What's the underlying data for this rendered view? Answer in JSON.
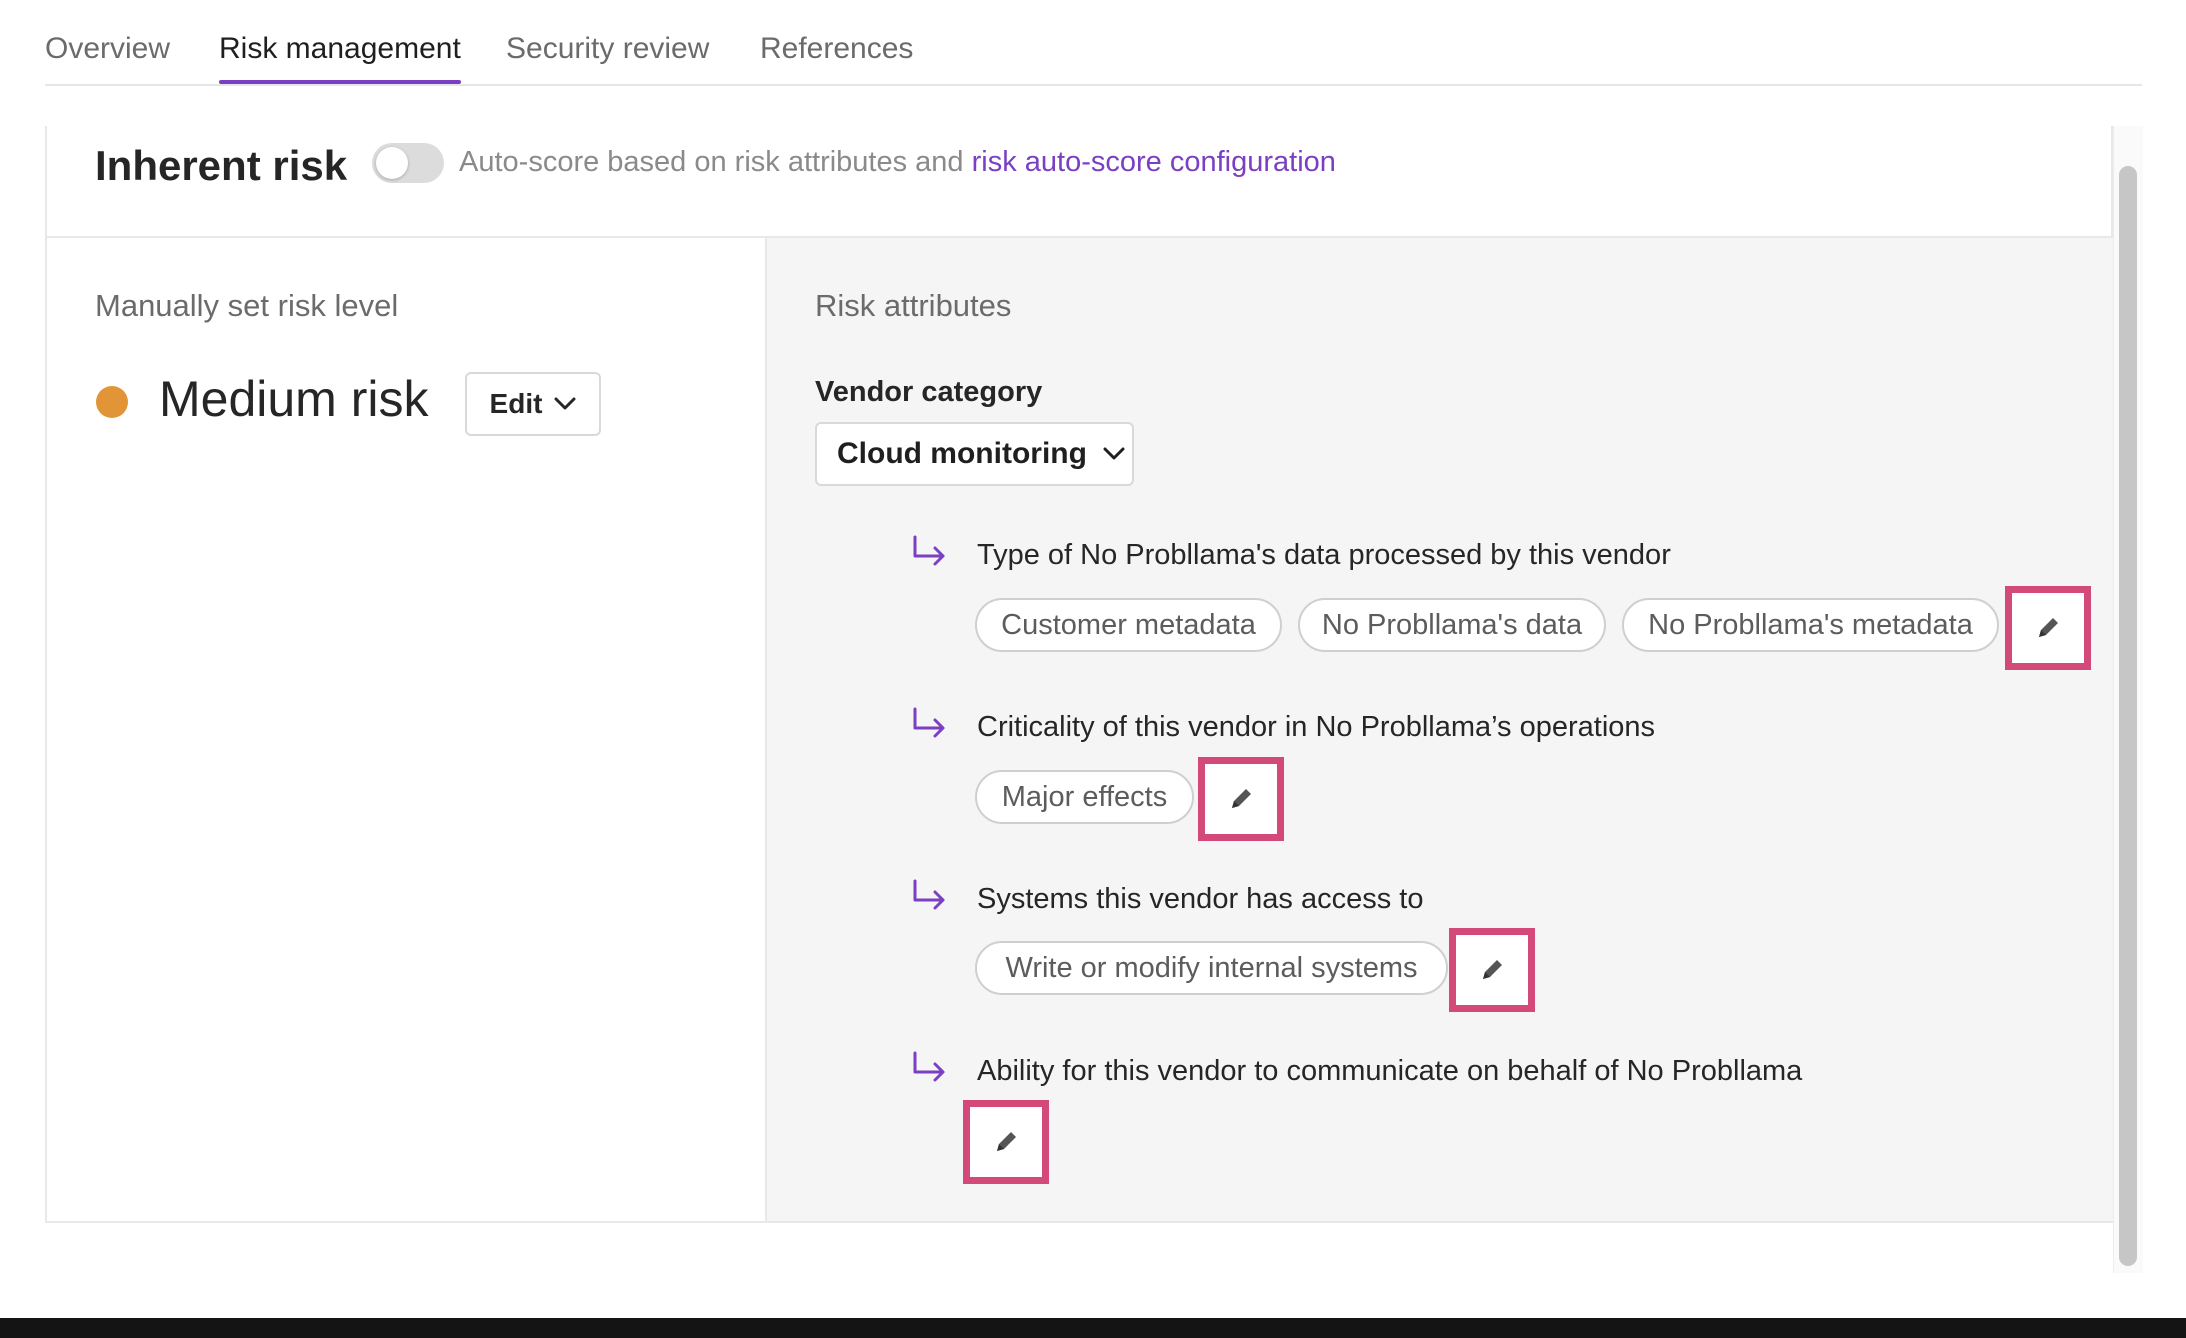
{
  "tabs": [
    {
      "label": "Overview"
    },
    {
      "label": "Risk management"
    },
    {
      "label": "Security review"
    },
    {
      "label": "References"
    }
  ],
  "header": {
    "title": "Inherent risk",
    "autoscore_text": "Auto-score based on risk attributes and ",
    "autoscore_link": "risk auto-score configuration",
    "toggle_on": false
  },
  "manual": {
    "label": "Manually set risk level",
    "risk_level": "Medium risk",
    "risk_color": "#e29536",
    "edit_label": "Edit"
  },
  "attributes": {
    "label": "Risk attributes",
    "vendor_category_label": "Vendor category",
    "vendor_category_value": "Cloud monitoring",
    "items": [
      {
        "title": "Type of No Probllama's data processed by this vendor",
        "chips": [
          "Customer metadata",
          "No Probllama's data",
          "No Probllama's metadata"
        ]
      },
      {
        "title": "Criticality of this vendor in No Probllama’s operations",
        "chips": [
          "Major effects"
        ]
      },
      {
        "title": "Systems this vendor has access to",
        "chips": [
          "Write or modify internal systems"
        ]
      },
      {
        "title": "Ability for this vendor to communicate on behalf of No Probllama",
        "chips": []
      }
    ]
  },
  "colors": {
    "accent": "#7b3fc4",
    "highlight": "#d2497a"
  }
}
